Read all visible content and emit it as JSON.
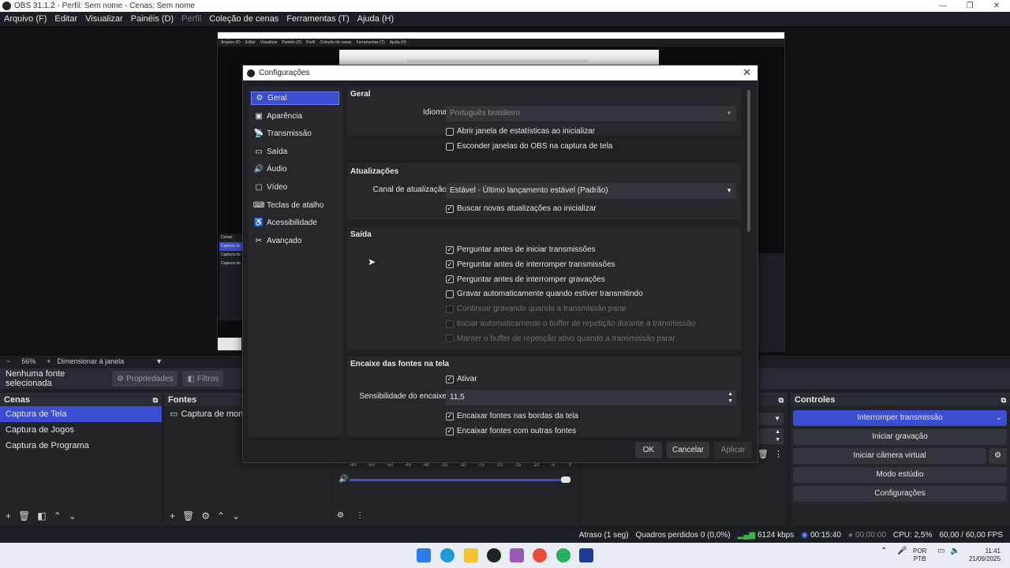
{
  "window": {
    "title": "OBS 31.1.2 - Perfil: Sem nome - Cenas: Sem nome",
    "controls": [
      "—",
      "❐",
      "✕"
    ]
  },
  "menu": [
    {
      "label": "Arquivo (F)",
      "dim": false
    },
    {
      "label": "Editar",
      "dim": false
    },
    {
      "label": "Visualizar",
      "dim": false
    },
    {
      "label": "Painéis (D)",
      "dim": false
    },
    {
      "label": "Perfil",
      "dim": true
    },
    {
      "label": "Coleção de cenas",
      "dim": false
    },
    {
      "label": "Ferramentas (T)",
      "dim": false
    },
    {
      "label": "Ajuda (H)",
      "dim": false
    }
  ],
  "preview": {
    "inner_menu": [
      "Arquivo (F)",
      "Editar",
      "Visualizar",
      "Painéis (D)",
      "Perfil",
      "Coleção de cenas",
      "Ferramentas (T)",
      "Ajuda (H)"
    ],
    "inner_scenes": [
      "Cenas",
      "Captura de",
      "Captura de",
      "Captura de"
    ]
  },
  "zoom": {
    "minus": "−",
    "value": "56%",
    "plus": "+",
    "mode": "Dimensionar à janela"
  },
  "source_toolbar": {
    "status": "Nenhuma fonte selecionada",
    "properties": "Propriedades",
    "filters": "Filtros"
  },
  "scenes": {
    "title": "Cenas",
    "items": [
      "Captura de Tela",
      "Captura de Jogos",
      "Captura de Programa"
    ],
    "selected": 0
  },
  "sources": {
    "title": "Fontes",
    "items": [
      "Captura de monitor"
    ]
  },
  "mixer": {
    "ticks": [
      "-60",
      "-55",
      "-50",
      "-45",
      "-40",
      "-35",
      "-30",
      "-25",
      "-20",
      "-15",
      "-10",
      "-5",
      "0"
    ],
    "volume": 1.0
  },
  "controls": {
    "title": "Controles",
    "buttons": [
      {
        "label": "Interromper transmissão",
        "active": true
      },
      {
        "label": "Iniciar gravação",
        "active": false
      },
      {
        "label": "Iniciar câmera virtual",
        "active": false
      },
      {
        "label": "Modo estúdio",
        "active": false
      },
      {
        "label": "Configurações",
        "active": false
      }
    ]
  },
  "status": {
    "delay": "Atraso (1 seg)",
    "dropped": "Quadros perdidos 0 (0,0%)",
    "bitrate": "6124 kbps",
    "stream_time": "00:15:40",
    "rec_time": "00:00:00",
    "cpu": "CPU: 2,5%",
    "fps": "60,00 / 60,00 FPS"
  },
  "taskbar": {
    "lang1": "POR",
    "lang2": "PTB",
    "time": "11:41",
    "date": "21/09/2025"
  },
  "dialog": {
    "title": "Configurações",
    "close": "✕",
    "nav": [
      {
        "label": "Geral",
        "icon": "gear-icon",
        "glyph": "⚙"
      },
      {
        "label": "Aparência",
        "icon": "appearance-icon",
        "glyph": "▣"
      },
      {
        "label": "Transmissão",
        "icon": "antenna-icon",
        "glyph": "📡"
      },
      {
        "label": "Saída",
        "icon": "output-icon",
        "glyph": "▭"
      },
      {
        "label": "Áudio",
        "icon": "speaker-icon",
        "glyph": "🔊"
      },
      {
        "label": "Vídeo",
        "icon": "monitor-icon",
        "glyph": "▢"
      },
      {
        "label": "Teclas de atalho",
        "icon": "keyboard-icon",
        "glyph": "⌨"
      },
      {
        "label": "Acessibilidade",
        "icon": "accessibility-icon",
        "glyph": "♿"
      },
      {
        "label": "Avançado",
        "icon": "tools-icon",
        "glyph": "✂"
      }
    ],
    "selected_nav": 0,
    "general": {
      "title": "Geral",
      "language_label": "Idioma",
      "language_value": "Português brasileiro",
      "open_stats": "Abrir janela de estatísticas ao inicializar",
      "hide_windows": "Esconder janelas do OBS na captura de tela"
    },
    "updates": {
      "title": "Atualizações",
      "channel_label": "Canal de atualização",
      "channel_value": "Estável - Último lançamento estável (Padrão)",
      "check_updates": "Buscar novas atualizações ao inicializar"
    },
    "output": {
      "title": "Saída",
      "options": [
        {
          "label": "Perguntar antes de iniciar transmissões",
          "checked": true,
          "disabled": false
        },
        {
          "label": "Perguntar antes de interromper transmissões",
          "checked": true,
          "disabled": false
        },
        {
          "label": "Perguntar antes de interromper gravações",
          "checked": true,
          "disabled": false
        },
        {
          "label": "Gravar automaticamente quando estiver transmitindo",
          "checked": false,
          "disabled": false
        },
        {
          "label": "Continuar gravando quando a transmissão parar",
          "checked": false,
          "disabled": true
        },
        {
          "label": "Iniciar automaticamente o buffer de repetição durante a transmissão",
          "checked": false,
          "disabled": true
        },
        {
          "label": "Manter o buffer de repetição ativo quando a transmissão parar",
          "checked": false,
          "disabled": true
        }
      ]
    },
    "snapping": {
      "title": "Encaixe das fontes na tela",
      "enable": "Ativar",
      "sensitivity_label": "Sensibilidade do encaixe",
      "sensitivity_value": "11,5",
      "screen_edges": "Encaixar fontes nas bordas da tela",
      "other_sources": "Encaixar fontes com outras fontes"
    },
    "buttons": {
      "ok": "OK",
      "cancel": "Cancelar",
      "apply": "Aplicar"
    }
  }
}
